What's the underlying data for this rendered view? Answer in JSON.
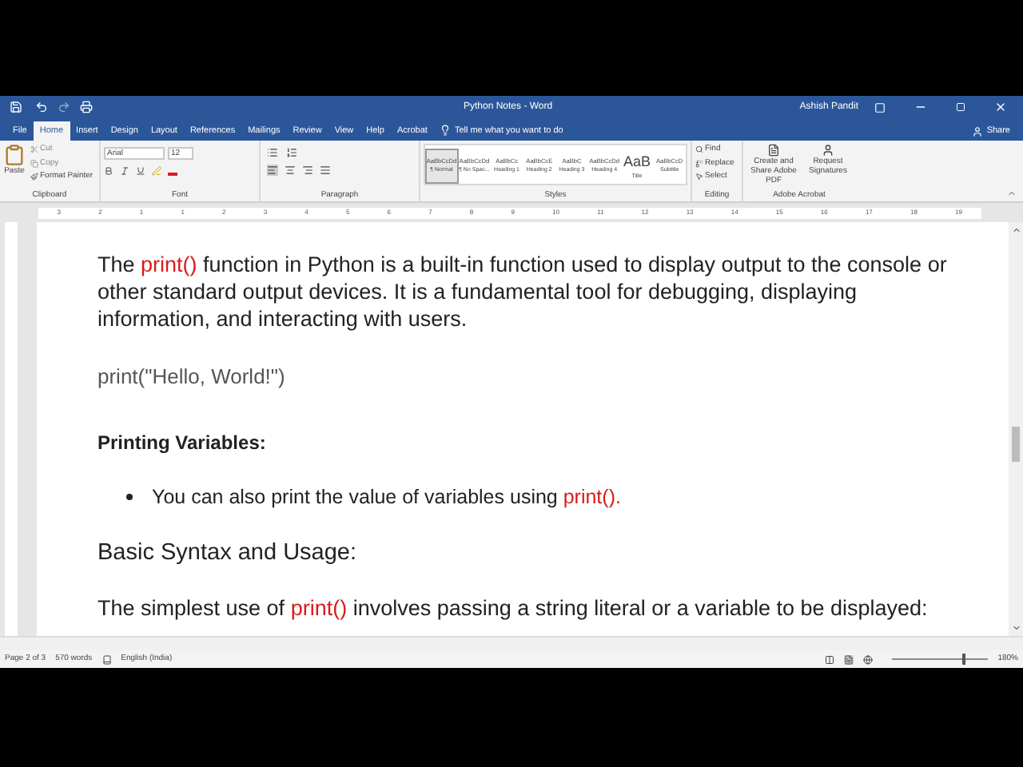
{
  "window": {
    "title": "Python Notes - Word",
    "user": "Ashish Pandit"
  },
  "tabs": [
    {
      "label": "File",
      "selected": false
    },
    {
      "label": "Home",
      "selected": true
    },
    {
      "label": "Insert",
      "selected": false
    },
    {
      "label": "Design",
      "selected": false
    },
    {
      "label": "Layout",
      "selected": false
    },
    {
      "label": "References",
      "selected": false
    },
    {
      "label": "Mailings",
      "selected": false
    },
    {
      "label": "Review",
      "selected": false
    },
    {
      "label": "View",
      "selected": false
    },
    {
      "label": "Help",
      "selected": false
    },
    {
      "label": "Acrobat",
      "selected": false
    }
  ],
  "tell_me": "Tell me what you want to do",
  "share": "Share",
  "clipboard": {
    "paste": "Paste",
    "cut": "Cut",
    "copy": "Copy",
    "format_painter": "Format Painter",
    "group": "Clipboard"
  },
  "font": {
    "name": "Arial",
    "size": "12",
    "group": "Font"
  },
  "paragraph": {
    "group": "Paragraph"
  },
  "styles": {
    "group": "Styles",
    "items": [
      {
        "preview": "AaBbCcDd",
        "name": "¶ Normal",
        "selected": true
      },
      {
        "preview": "AaBbCcDd",
        "name": "¶ No Spac...",
        "selected": false
      },
      {
        "preview": "AaBbCc",
        "name": "Heading 1",
        "selected": false
      },
      {
        "preview": "AaBbCcE",
        "name": "Heading 2",
        "selected": false
      },
      {
        "preview": "AaBbC",
        "name": "Heading 3",
        "selected": false
      },
      {
        "preview": "AaBbCcDd",
        "name": "Heading 4",
        "selected": false
      },
      {
        "preview": "AaB",
        "name": "Title",
        "selected": false
      },
      {
        "preview": "AaBbCcD",
        "name": "Subtitle",
        "selected": false
      }
    ]
  },
  "editing": {
    "group": "Editing",
    "find": "Find",
    "replace": "Replace",
    "select": "Select"
  },
  "acrobat": {
    "group": "Adobe Acrobat",
    "create": "Create and Share Adobe PDF",
    "request": "Request Signatures"
  },
  "ruler": [
    "3",
    "2",
    "1",
    "1",
    "2",
    "3",
    "4",
    "5",
    "6",
    "7",
    "8",
    "9",
    "10",
    "11",
    "12",
    "13",
    "14",
    "15",
    "16",
    "17",
    "18",
    "19"
  ],
  "document": [
    {
      "kind": "paragraph",
      "parts": [
        {
          "text": "The ",
          "keyword": false
        },
        {
          "text": "print()",
          "keyword": true
        },
        {
          "text": " function in Python is a built-in function used to display output to the console or other standard output devices. It is a fundamental tool for debugging, displaying information, and interacting with users.",
          "keyword": false
        }
      ]
    },
    {
      "kind": "code",
      "text": "print(\"Hello, World!\")"
    },
    {
      "kind": "subheading",
      "text": "Printing Variables:"
    },
    {
      "kind": "bullet",
      "parts": [
        {
          "text": "You can also print the value of variables using ",
          "keyword": false
        },
        {
          "text": "print().",
          "keyword": true
        }
      ]
    },
    {
      "kind": "heading",
      "text": "Basic Syntax and Usage:"
    },
    {
      "kind": "paragraph",
      "parts": [
        {
          "text": "The simplest use of ",
          "keyword": false
        },
        {
          "text": "print()",
          "keyword": true
        },
        {
          "text": " involves passing a string literal or a variable to be displayed:",
          "keyword": false
        }
      ]
    }
  ],
  "status_bar": {
    "page": "Page 2 of 3",
    "words": "570 words",
    "language": "English (India)",
    "zoom": "180%",
    "zoom_slider": {
      "level": 0.75
    }
  }
}
